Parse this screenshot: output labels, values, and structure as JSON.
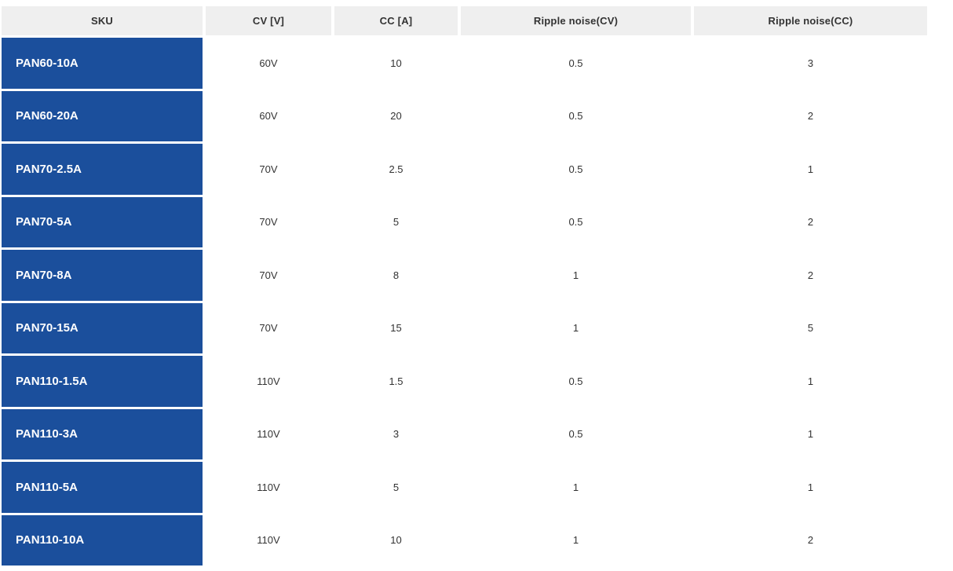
{
  "colors": {
    "sku_cell_bg": "#1b4f9c",
    "header_bg": "#efefef",
    "header_text": "#333333",
    "body_text": "#333333",
    "sku_text": "#ffffff",
    "page_bg": "#ffffff"
  },
  "table": {
    "columns": [
      {
        "key": "sku",
        "label": "SKU"
      },
      {
        "key": "cv",
        "label": "CV [V]"
      },
      {
        "key": "cc",
        "label": "CC [A]"
      },
      {
        "key": "ripple_cv",
        "label": "Ripple noise(CV)"
      },
      {
        "key": "ripple_cc",
        "label": "Ripple noise(CC)"
      }
    ],
    "rows": [
      {
        "sku": "PAN60-10A",
        "cv": "60V",
        "cc": "10",
        "ripple_cv": "0.5",
        "ripple_cc": "3"
      },
      {
        "sku": "PAN60-20A",
        "cv": "60V",
        "cc": "20",
        "ripple_cv": "0.5",
        "ripple_cc": "2"
      },
      {
        "sku": "PAN70-2.5A",
        "cv": "70V",
        "cc": "2.5",
        "ripple_cv": "0.5",
        "ripple_cc": "1"
      },
      {
        "sku": "PAN70-5A",
        "cv": "70V",
        "cc": "5",
        "ripple_cv": "0.5",
        "ripple_cc": "2"
      },
      {
        "sku": "PAN70-8A",
        "cv": "70V",
        "cc": "8",
        "ripple_cv": "1",
        "ripple_cc": "2"
      },
      {
        "sku": "PAN70-15A",
        "cv": "70V",
        "cc": "15",
        "ripple_cv": "1",
        "ripple_cc": "5"
      },
      {
        "sku": "PAN110-1.5A",
        "cv": "110V",
        "cc": "1.5",
        "ripple_cv": "0.5",
        "ripple_cc": "1"
      },
      {
        "sku": "PAN110-3A",
        "cv": "110V",
        "cc": "3",
        "ripple_cv": "0.5",
        "ripple_cc": "1"
      },
      {
        "sku": "PAN110-5A",
        "cv": "110V",
        "cc": "5",
        "ripple_cv": "1",
        "ripple_cc": "1"
      },
      {
        "sku": "PAN110-10A",
        "cv": "110V",
        "cc": "10",
        "ripple_cv": "1",
        "ripple_cc": "2"
      }
    ]
  }
}
